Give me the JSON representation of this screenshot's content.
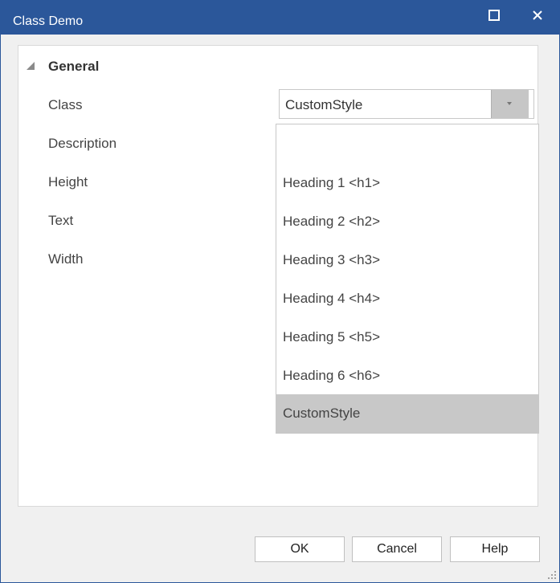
{
  "window": {
    "title": "Class Demo"
  },
  "titlebar_icons": {
    "maximize": "maximize-icon",
    "close": "close-icon"
  },
  "category": {
    "label": "General",
    "icon": "collapse-triangle-icon"
  },
  "properties": [
    {
      "label": "Class",
      "value": "CustomStyle"
    },
    {
      "label": "Description"
    },
    {
      "label": "Height"
    },
    {
      "label": "Text"
    },
    {
      "label": "Width"
    }
  ],
  "combo": {
    "value": "CustomStyle",
    "button_icon": "dropdown-caret-icon"
  },
  "dropdown": {
    "items": [
      "",
      "Heading 1 <h1>",
      "Heading 2 <h2>",
      "Heading 3 <h3>",
      "Heading 4 <h4>",
      "Heading 5 <h5>",
      "Heading 6 <h6>",
      "CustomStyle"
    ],
    "selected": "CustomStyle"
  },
  "buttons": {
    "ok": "OK",
    "cancel": "Cancel",
    "help": "Help"
  },
  "colors": {
    "titlebar": "#2b579a",
    "selection": "#c8c8c8"
  }
}
